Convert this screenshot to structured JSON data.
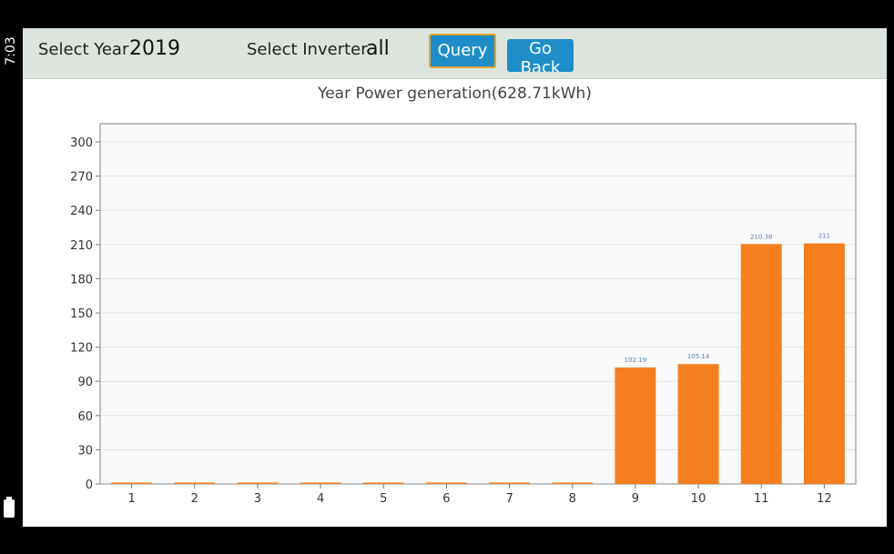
{
  "status": {
    "time": "7:03",
    "battery_icon": "battery-icon"
  },
  "toolbar": {
    "year_label": "Select Year",
    "year_value": "2019",
    "inverter_label": "Select Inverter",
    "inverter_value": "all",
    "query_label": "Query",
    "back_label": "Go Back"
  },
  "colors": {
    "bar": "#f57f1f",
    "toolbar": "#dde4dd",
    "button": "#1f8ec8",
    "value_label": "#5b7fb0"
  },
  "chart_data": {
    "type": "bar",
    "title": "Year Power generation(628.71kWh)",
    "categories": [
      "1",
      "2",
      "3",
      "4",
      "5",
      "6",
      "7",
      "8",
      "9",
      "10",
      "11",
      "12"
    ],
    "values": [
      0,
      0,
      0,
      0,
      0,
      0,
      0,
      0,
      102.19,
      105.14,
      210.38,
      211
    ],
    "value_labels": [
      "",
      "",
      "",
      "",
      "",
      "",
      "",
      "",
      "102.19",
      "105.14",
      "210.38",
      "211"
    ],
    "yticks": [
      0,
      30,
      60,
      90,
      120,
      150,
      180,
      210,
      240,
      270,
      300
    ],
    "ylim": [
      0,
      300
    ],
    "grid": true
  }
}
